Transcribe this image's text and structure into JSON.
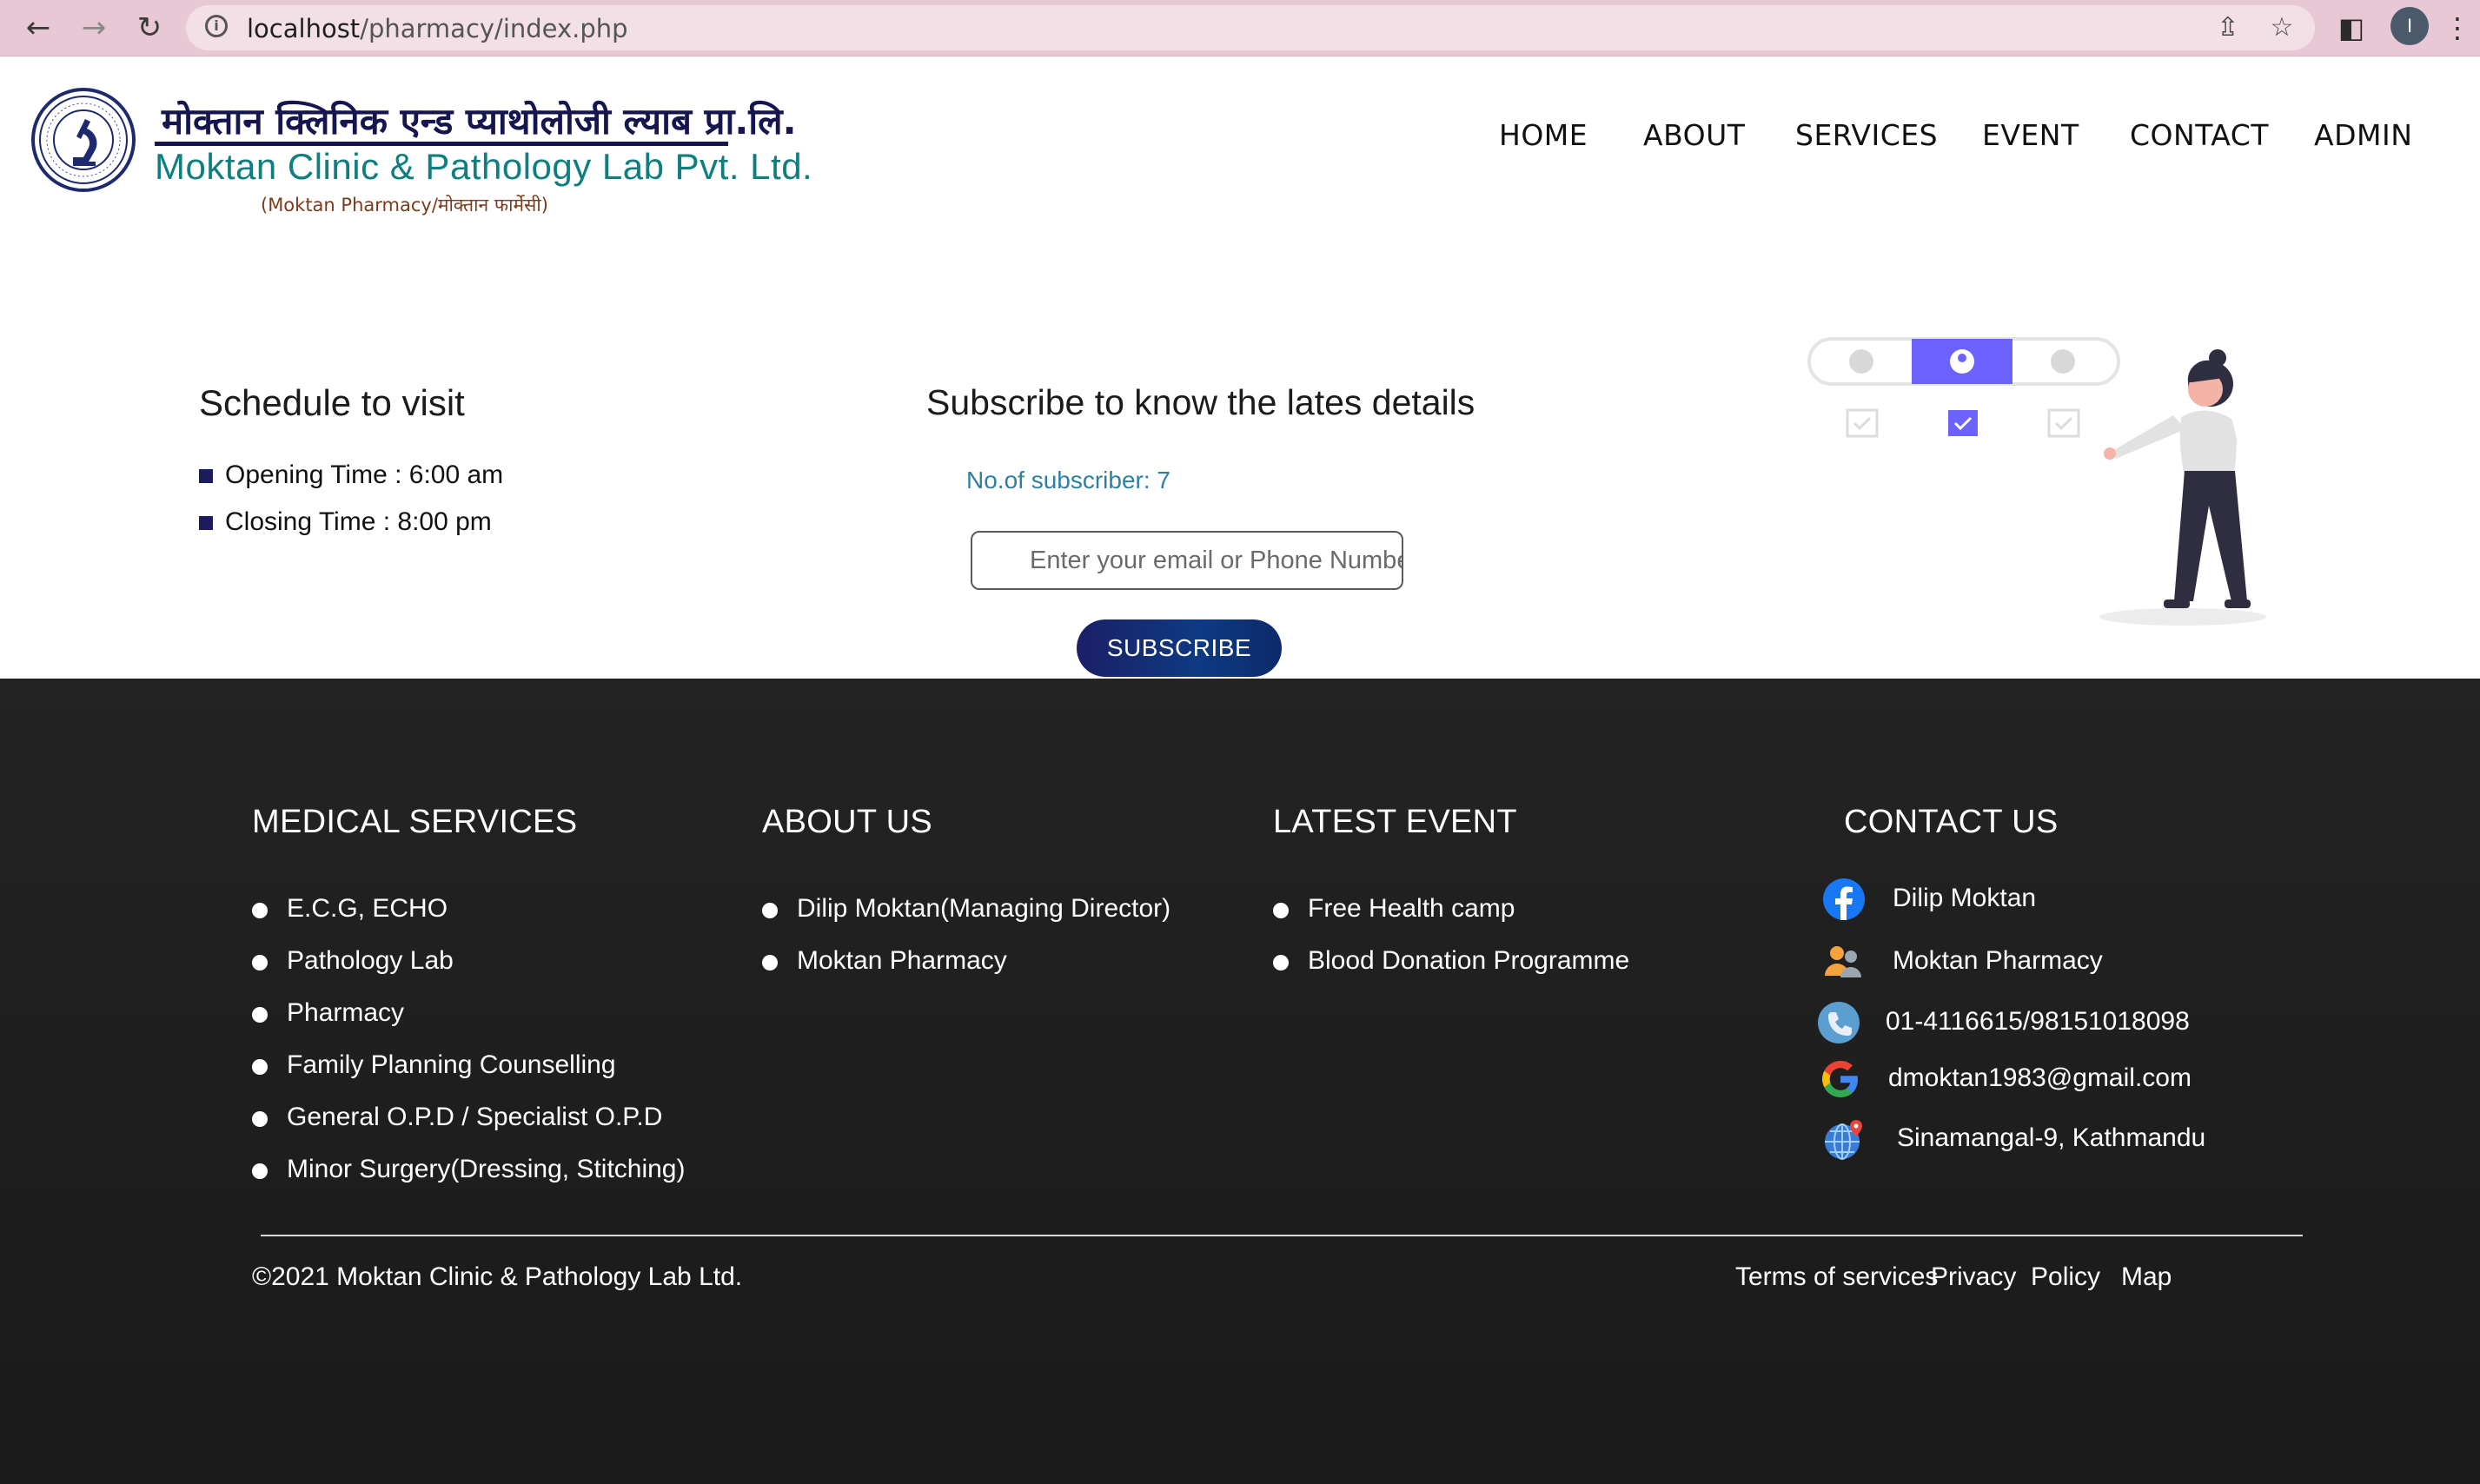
{
  "browser": {
    "url_host": "localhost",
    "url_path": "/pharmacy/index.php",
    "profile_initial": "I",
    "icons": [
      "back-arrow-icon",
      "forward-arrow-icon",
      "reload-icon",
      "info-icon",
      "share-icon",
      "star-icon",
      "side-panel-icon",
      "kebab-menu-icon"
    ]
  },
  "header": {
    "logo_nepali": "मोक्तान क्लिनिक एन्ड प्याथोलोजी ल्याब प्रा.लि.",
    "logo_english": "Moktan Clinic & Pathology Lab Pvt. Ltd.",
    "logo_sub": "(Moktan Pharmacy/मोक्तान फार्मेसी)",
    "nav": [
      {
        "label": "HOME"
      },
      {
        "label": "ABOUT"
      },
      {
        "label": "SERVICES"
      },
      {
        "label": "EVENT"
      },
      {
        "label": "CONTACT"
      },
      {
        "label": "ADMIN"
      }
    ]
  },
  "schedule": {
    "title": "Schedule to visit",
    "items": [
      "Opening Time : 6:00 am",
      "Closing Time : 8:00 pm"
    ]
  },
  "subscribe": {
    "title": "Subscribe to know the lates details",
    "count_text": "No.of subscriber: 7",
    "input_placeholder": "Enter your email or Phone Number",
    "input_value": "",
    "button_label": "SUBSCRIBE"
  },
  "footer": {
    "medical": {
      "title": "MEDICAL SERVICES",
      "items": [
        "E.C.G, ECHO",
        "Pathology Lab",
        "Pharmacy",
        "Family Planning Counselling",
        "General O.P.D / Specialist O.P.D",
        "Minor Surgery(Dressing, Stitching)"
      ]
    },
    "about": {
      "title": "ABOUT US",
      "items": [
        "Dilip Moktan(Managing Director)",
        "Moktan Pharmacy"
      ]
    },
    "events": {
      "title": "LATEST EVENT",
      "items": [
        "Free Health camp",
        "Blood Donation Programme"
      ]
    },
    "contact": {
      "title": "CONTACT US",
      "items": [
        {
          "icon": "facebook-icon",
          "text": "Dilip Moktan"
        },
        {
          "icon": "people-icon",
          "text": "Moktan Pharmacy"
        },
        {
          "icon": "phone-icon",
          "text": "01-4116615/98151018098"
        },
        {
          "icon": "google-icon",
          "text": "dmoktan1983@gmail.com"
        },
        {
          "icon": "globe-location-icon",
          "text": "Sinamangal-9, Kathmandu"
        }
      ]
    },
    "copyright": "©2021 Moktan Clinic & Pathology Lab Ltd.",
    "legal": [
      {
        "label": "Terms of services"
      },
      {
        "label": "Privacy"
      },
      {
        "label": "Policy"
      },
      {
        "label": "Map"
      }
    ]
  },
  "colors": {
    "brand_navy": "#15154f",
    "brand_teal": "#0f7e80",
    "accent_purple": "#6c63ff",
    "footer_bg": "#1f1f1f",
    "subscriber_count": "#2f7fa3"
  }
}
